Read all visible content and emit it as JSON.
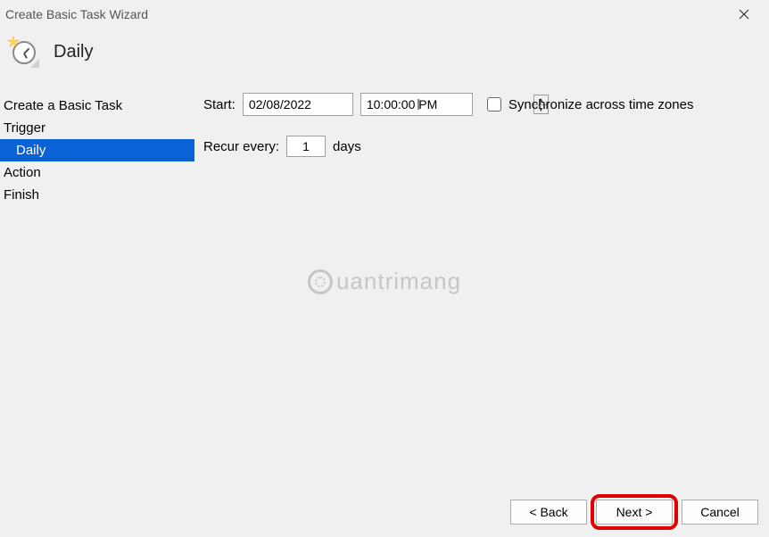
{
  "window": {
    "title": "Create Basic Task Wizard",
    "heading": "Daily"
  },
  "sidebar": {
    "items": [
      {
        "label": "Create a Basic Task",
        "sub": false,
        "selected": false
      },
      {
        "label": "Trigger",
        "sub": false,
        "selected": false
      },
      {
        "label": "Daily",
        "sub": true,
        "selected": true
      },
      {
        "label": "Action",
        "sub": false,
        "selected": false
      },
      {
        "label": "Finish",
        "sub": false,
        "selected": false
      }
    ]
  },
  "content": {
    "start_label": "Start:",
    "date_value": "02/08/2022",
    "time_value": "10:00:00 PM",
    "sync_label": "Synchronize across time zones",
    "sync_checked": false,
    "recur_label": "Recur every:",
    "recur_value": "1",
    "recur_unit": "days"
  },
  "watermark": {
    "text": "uantrimang"
  },
  "buttons": {
    "back": "< Back",
    "next": "Next >",
    "cancel": "Cancel"
  }
}
